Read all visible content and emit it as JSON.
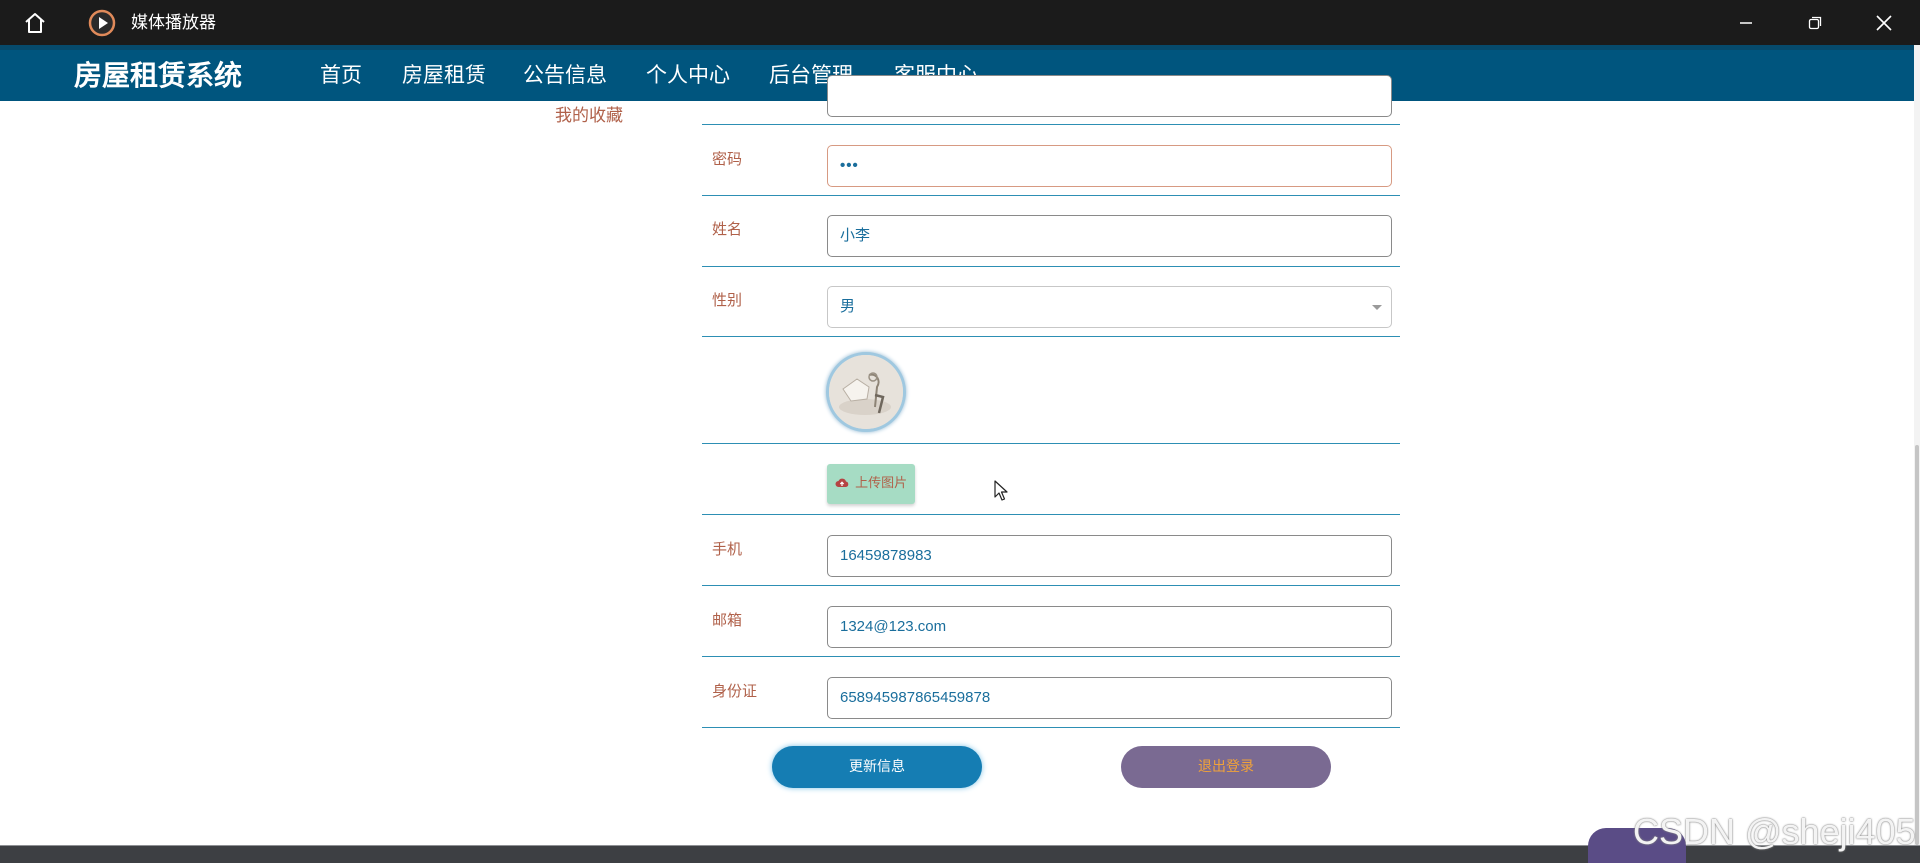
{
  "player": {
    "title": "媒体播放器",
    "home_icon": "home-icon",
    "app_icon": "play-circle-icon",
    "controls": [
      "minimize-icon",
      "maximize-icon",
      "close-icon"
    ]
  },
  "site": {
    "brand": "房屋租赁系统",
    "nav": [
      "首页",
      "房屋租赁",
      "公告信息",
      "个人中心",
      "后台管理",
      "客服中心"
    ],
    "active_nav": "首页"
  },
  "sidebar": {
    "link": "我的收藏"
  },
  "form": {
    "password_label": "密码",
    "password_value": "•••",
    "name_label": "姓名",
    "name_value": "小李",
    "gender_label": "性别",
    "gender_value": "男",
    "upload_label": "上传图片",
    "phone_label": "手机",
    "phone_value": "16459878983",
    "email_label": "邮箱",
    "email_value": "1324@123.com",
    "idcard_label": "身份证",
    "idcard_value": "658945987865459878",
    "update_button": "更新信息",
    "logout_button": "退出登录"
  },
  "watermark": "CSDN @sheji405",
  "colors": {
    "nav_bg": "#00557e",
    "label": "#b0614a",
    "field_text": "#1a6e9c",
    "row_divider": "#2d8fb4",
    "update_btn": "#157db3",
    "logout_btn": "#7a6a92",
    "upload_btn": "#a6dcc4"
  }
}
